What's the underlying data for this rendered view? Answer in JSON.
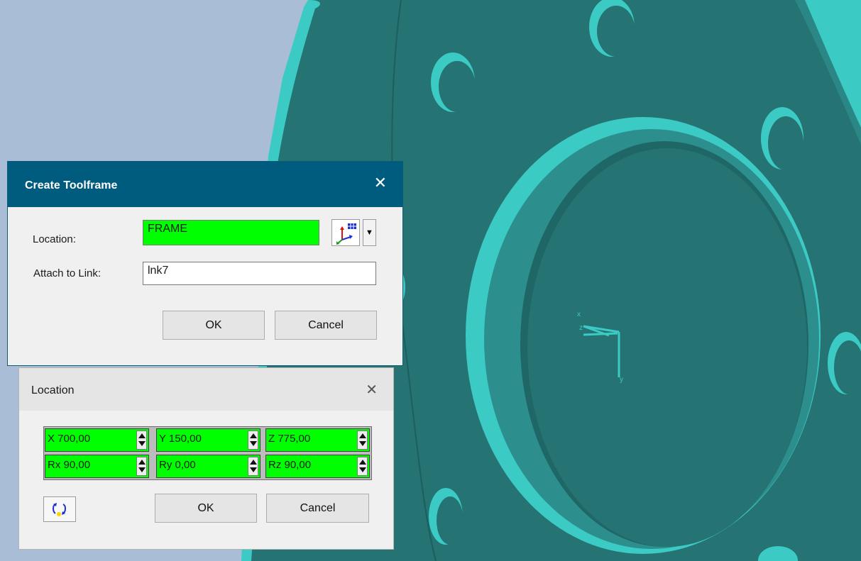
{
  "create_toolframe": {
    "title": "Create Toolframe",
    "close_symbol": "✕",
    "location_label": "Location:",
    "location_value": "FRAME",
    "location_icon": "frame-picker-icon",
    "attach_label": "Attach to Link:",
    "attach_value": "lnk7",
    "ok_label": "OK",
    "cancel_label": "Cancel"
  },
  "location_dialog": {
    "title": "Location",
    "close_symbol": "✕",
    "fields": [
      {
        "axis": "X",
        "value": "700,00"
      },
      {
        "axis": "Y",
        "value": "150,00"
      },
      {
        "axis": "Z",
        "value": "775,00"
      },
      {
        "axis": "Rx",
        "value": "90,00"
      },
      {
        "axis": "Ry",
        "value": "0,00"
      },
      {
        "axis": "Rz",
        "value": "90,00"
      }
    ],
    "field_texts": [
      "X 700,00",
      "Y 150,00",
      "Z 775,00",
      "Rx 90,00",
      "Ry 0,00",
      "Rz 90,00"
    ],
    "reset_icon": "rotate-icon",
    "ok_label": "OK",
    "cancel_label": "Cancel"
  },
  "viewport": {
    "background_color": "#a9bdd6",
    "model_color": "#267473",
    "highlight_color": "#3ccac4",
    "triad_x_label": "x",
    "triad_y_label": "y",
    "triad_z_label": "z"
  }
}
